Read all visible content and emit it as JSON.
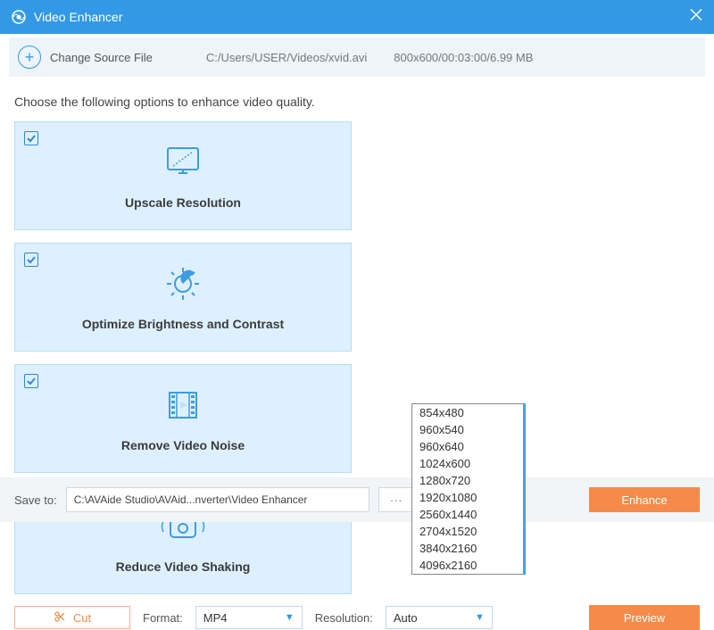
{
  "titlebar": {
    "title": "Video Enhancer"
  },
  "source": {
    "change_label": "Change Source File",
    "path": "C:/Users/USER/Videos/xvid.avi",
    "meta": "800x600/00:03:00/6.99 MB"
  },
  "instruction": "Choose the following options to enhance video quality.",
  "tiles": {
    "upscale": "Upscale Resolution",
    "brightness": "Optimize Brightness and Contrast",
    "noise": "Remove Video Noise",
    "shaking": "Reduce Video Shaking"
  },
  "controls": {
    "cut": "Cut",
    "format_label": "Format:",
    "format_value": "MP4",
    "resolution_label": "Resolution:",
    "resolution_value": "Auto",
    "preview": "Preview"
  },
  "resolution_options": {
    "o0": "854x480",
    "o1": "960x540",
    "o2": "960x640",
    "o3": "1024x600",
    "o4": "1280x720",
    "o5": "1920x1080",
    "o6": "2560x1440",
    "o7": "2704x1520",
    "o8": "3840x2160",
    "o9": "4096x2160"
  },
  "save": {
    "label": "Save to:",
    "path": "C:\\AVAide Studio\\AVAid...nverter\\Video Enhancer",
    "browse": "···",
    "enhance": "Enhance"
  }
}
